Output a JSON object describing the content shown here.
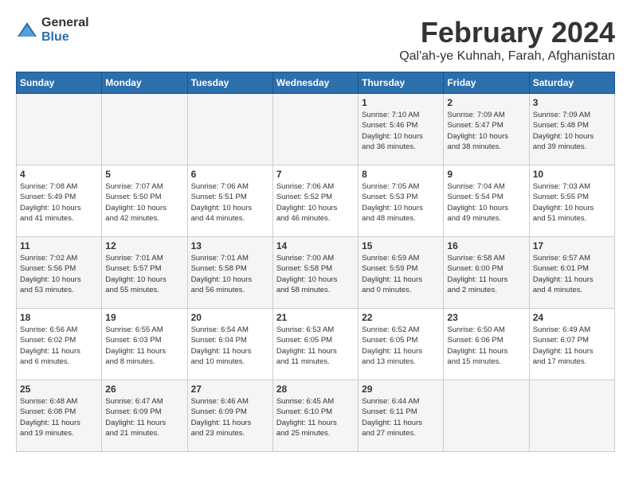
{
  "logo": {
    "general": "General",
    "blue": "Blue"
  },
  "title": "February 2024",
  "subtitle": "Qal'ah-ye Kuhnah, Farah, Afghanistan",
  "days_header": [
    "Sunday",
    "Monday",
    "Tuesday",
    "Wednesday",
    "Thursday",
    "Friday",
    "Saturday"
  ],
  "weeks": [
    [
      {
        "day": "",
        "info": ""
      },
      {
        "day": "",
        "info": ""
      },
      {
        "day": "",
        "info": ""
      },
      {
        "day": "",
        "info": ""
      },
      {
        "day": "1",
        "info": "Sunrise: 7:10 AM\nSunset: 5:46 PM\nDaylight: 10 hours\nand 36 minutes."
      },
      {
        "day": "2",
        "info": "Sunrise: 7:09 AM\nSunset: 5:47 PM\nDaylight: 10 hours\nand 38 minutes."
      },
      {
        "day": "3",
        "info": "Sunrise: 7:09 AM\nSunset: 5:48 PM\nDaylight: 10 hours\nand 39 minutes."
      }
    ],
    [
      {
        "day": "4",
        "info": "Sunrise: 7:08 AM\nSunset: 5:49 PM\nDaylight: 10 hours\nand 41 minutes."
      },
      {
        "day": "5",
        "info": "Sunrise: 7:07 AM\nSunset: 5:50 PM\nDaylight: 10 hours\nand 42 minutes."
      },
      {
        "day": "6",
        "info": "Sunrise: 7:06 AM\nSunset: 5:51 PM\nDaylight: 10 hours\nand 44 minutes."
      },
      {
        "day": "7",
        "info": "Sunrise: 7:06 AM\nSunset: 5:52 PM\nDaylight: 10 hours\nand 46 minutes."
      },
      {
        "day": "8",
        "info": "Sunrise: 7:05 AM\nSunset: 5:53 PM\nDaylight: 10 hours\nand 48 minutes."
      },
      {
        "day": "9",
        "info": "Sunrise: 7:04 AM\nSunset: 5:54 PM\nDaylight: 10 hours\nand 49 minutes."
      },
      {
        "day": "10",
        "info": "Sunrise: 7:03 AM\nSunset: 5:55 PM\nDaylight: 10 hours\nand 51 minutes."
      }
    ],
    [
      {
        "day": "11",
        "info": "Sunrise: 7:02 AM\nSunset: 5:56 PM\nDaylight: 10 hours\nand 53 minutes."
      },
      {
        "day": "12",
        "info": "Sunrise: 7:01 AM\nSunset: 5:57 PM\nDaylight: 10 hours\nand 55 minutes."
      },
      {
        "day": "13",
        "info": "Sunrise: 7:01 AM\nSunset: 5:58 PM\nDaylight: 10 hours\nand 56 minutes."
      },
      {
        "day": "14",
        "info": "Sunrise: 7:00 AM\nSunset: 5:58 PM\nDaylight: 10 hours\nand 58 minutes."
      },
      {
        "day": "15",
        "info": "Sunrise: 6:59 AM\nSunset: 5:59 PM\nDaylight: 11 hours\nand 0 minutes."
      },
      {
        "day": "16",
        "info": "Sunrise: 6:58 AM\nSunset: 6:00 PM\nDaylight: 11 hours\nand 2 minutes."
      },
      {
        "day": "17",
        "info": "Sunrise: 6:57 AM\nSunset: 6:01 PM\nDaylight: 11 hours\nand 4 minutes."
      }
    ],
    [
      {
        "day": "18",
        "info": "Sunrise: 6:56 AM\nSunset: 6:02 PM\nDaylight: 11 hours\nand 6 minutes."
      },
      {
        "day": "19",
        "info": "Sunrise: 6:55 AM\nSunset: 6:03 PM\nDaylight: 11 hours\nand 8 minutes."
      },
      {
        "day": "20",
        "info": "Sunrise: 6:54 AM\nSunset: 6:04 PM\nDaylight: 11 hours\nand 10 minutes."
      },
      {
        "day": "21",
        "info": "Sunrise: 6:53 AM\nSunset: 6:05 PM\nDaylight: 11 hours\nand 11 minutes."
      },
      {
        "day": "22",
        "info": "Sunrise: 6:52 AM\nSunset: 6:05 PM\nDaylight: 11 hours\nand 13 minutes."
      },
      {
        "day": "23",
        "info": "Sunrise: 6:50 AM\nSunset: 6:06 PM\nDaylight: 11 hours\nand 15 minutes."
      },
      {
        "day": "24",
        "info": "Sunrise: 6:49 AM\nSunset: 6:07 PM\nDaylight: 11 hours\nand 17 minutes."
      }
    ],
    [
      {
        "day": "25",
        "info": "Sunrise: 6:48 AM\nSunset: 6:08 PM\nDaylight: 11 hours\nand 19 minutes."
      },
      {
        "day": "26",
        "info": "Sunrise: 6:47 AM\nSunset: 6:09 PM\nDaylight: 11 hours\nand 21 minutes."
      },
      {
        "day": "27",
        "info": "Sunrise: 6:46 AM\nSunset: 6:09 PM\nDaylight: 11 hours\nand 23 minutes."
      },
      {
        "day": "28",
        "info": "Sunrise: 6:45 AM\nSunset: 6:10 PM\nDaylight: 11 hours\nand 25 minutes."
      },
      {
        "day": "29",
        "info": "Sunrise: 6:44 AM\nSunset: 6:11 PM\nDaylight: 11 hours\nand 27 minutes."
      },
      {
        "day": "",
        "info": ""
      },
      {
        "day": "",
        "info": ""
      }
    ]
  ]
}
